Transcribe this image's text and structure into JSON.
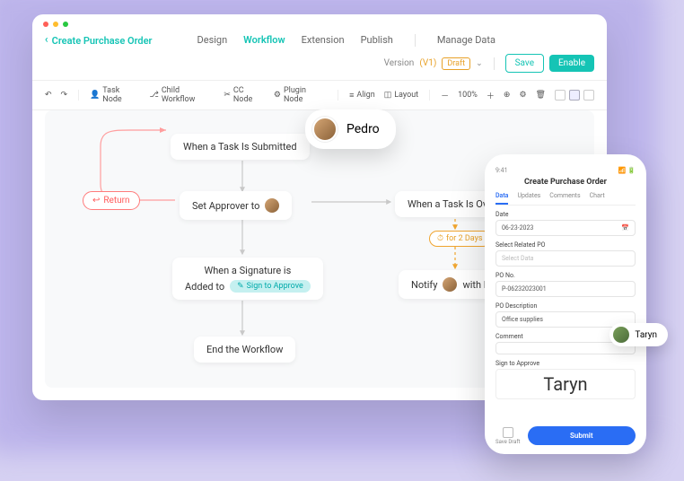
{
  "window": {
    "back_label": "Create Purchase Order",
    "tabs": [
      "Design",
      "Workflow",
      "Extension",
      "Publish"
    ],
    "active_tab": 1,
    "manage_data": "Manage Data",
    "version_label": "Version",
    "version_value": "(V1)",
    "draft_badge": "Draft",
    "save": "Save",
    "enable": "Enable"
  },
  "toolbar": {
    "task_node": "Task Node",
    "child_workflow": "Child Workflow",
    "cc_node": "CC Node",
    "plugin_node": "Plugin Node",
    "align": "Align",
    "layout": "Layout",
    "zoom": "100%"
  },
  "pedro": {
    "name": "Pedro"
  },
  "flow": {
    "return": "Return",
    "submitted": "When a Task Is Submitted",
    "set_approver_prefix": "Set Approver to",
    "overdue": "When a Task Is Overdue",
    "for_days": "for 2 Days",
    "signature_line1": "When a Signature is",
    "signature_line2_prefix": "Added to",
    "sign_chip": "Sign to Approve",
    "notify_prefix": "Notify",
    "notify_suffix": "with Email",
    "end": "End the Workflow"
  },
  "phone": {
    "time": "9:41",
    "title": "Create Purchase Order",
    "tabs": [
      "Data",
      "Updates",
      "Comments",
      "Chart"
    ],
    "active_tab": 0,
    "fields": {
      "date_label": "Date",
      "date_value": "06-23-2023",
      "related_label": "Select Related PO",
      "related_placeholder": "Select Data",
      "po_no_label": "PO No.",
      "po_no_value": "P-06232023001",
      "desc_label": "PO Description",
      "desc_value": "Office supplies",
      "comment_label": "Comment",
      "sign_label": "Sign to Approve",
      "signature": "Taryn"
    },
    "save_draft": "Save Draft",
    "submit": "Submit"
  },
  "taryn": {
    "name": "Taryn"
  }
}
